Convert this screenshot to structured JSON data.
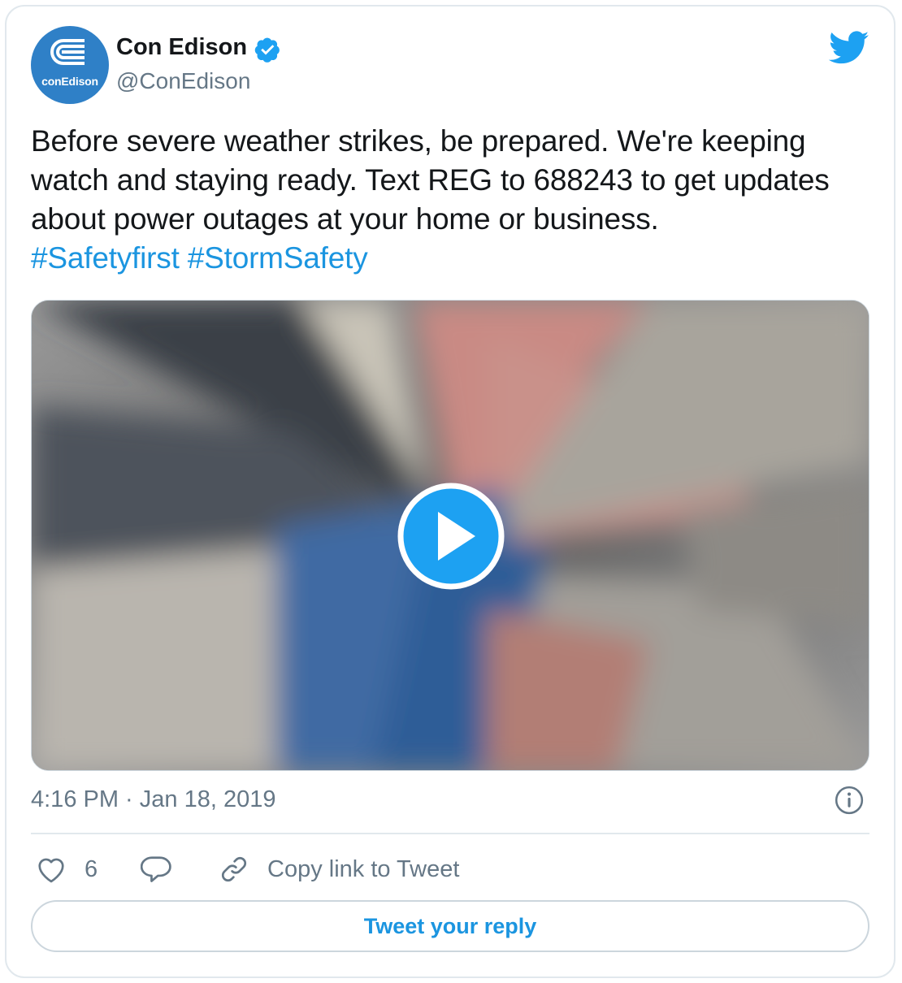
{
  "author": {
    "name": "Con Edison",
    "handle": "@ConEdison",
    "avatar_brand": "conEdison",
    "verified": true
  },
  "tweet": {
    "text": "Before severe weather strikes, be prepared. We're keeping watch and staying ready. Text REG to 688243 to get updates about power outages at your home or business.",
    "hashtags": "#Safetyfirst #StormSafety",
    "timestamp": "4:16 PM · Jan 18, 2019"
  },
  "actions": {
    "like_count": "6",
    "copy_link_label": "Copy link to Tweet",
    "reply_button_label": "Tweet your reply"
  },
  "icons": {
    "brand": "twitter-bird-icon",
    "verified": "verified-badge-icon",
    "play": "play-icon",
    "info": "info-icon",
    "like": "heart-icon",
    "reply": "reply-bubble-icon",
    "link": "link-icon"
  },
  "colors": {
    "accent": "#1b95e0",
    "twitter_blue": "#1da1f2",
    "secondary_text": "#657786",
    "primary_text": "#14171a",
    "border": "#e1e8ed",
    "avatar_bg": "#2f80c7"
  }
}
